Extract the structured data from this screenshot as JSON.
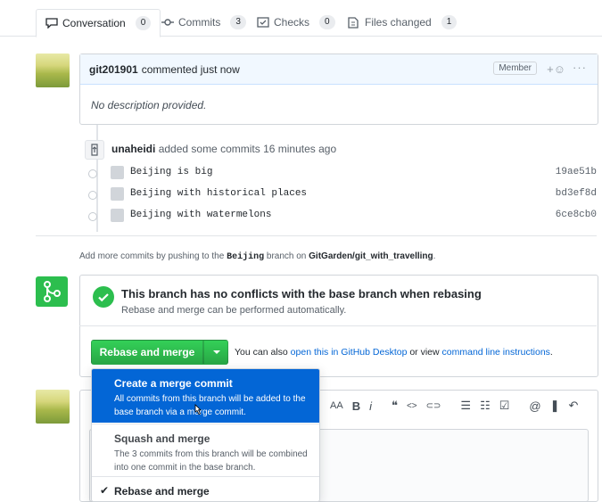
{
  "tabs": [
    {
      "label": "Conversation",
      "count": "0",
      "icon": "conversation-icon"
    },
    {
      "label": "Commits",
      "count": "3",
      "icon": "commit-icon"
    },
    {
      "label": "Checks",
      "count": "0",
      "icon": "checks-icon"
    },
    {
      "label": "Files changed",
      "count": "1",
      "icon": "file-diff-icon"
    }
  ],
  "comment": {
    "author": "git201901",
    "action": "commented just now",
    "badge": "Member",
    "body": "No description provided."
  },
  "timeline": {
    "actor": "unaheidi",
    "text": "added some commits 16 minutes ago",
    "commits": [
      {
        "message": "Beijing is big",
        "sha": "19ae51b"
      },
      {
        "message": "Beijing with historical places",
        "sha": "bd3ef8d"
      },
      {
        "message": "Beijing with watermelons",
        "sha": "6ce8cb0"
      }
    ]
  },
  "push_note": {
    "prefix": "Add more commits by pushing to the",
    "branch": "Beijing",
    "middle": "branch on",
    "repo": "GitGarden/git_with_travelling",
    "suffix": "."
  },
  "merge": {
    "title": "This branch has no conflicts with the base branch when rebasing",
    "subtitle": "Rebase and merge can be performed automatically.",
    "button": "Rebase and merge",
    "also_prefix": "You can also",
    "desktop_link": "open this in GitHub Desktop",
    "also_middle": "or view",
    "cli_link": "command line instructions",
    "also_suffix": ".",
    "accent": "#2cbe4e"
  },
  "dropdown": {
    "items": [
      {
        "title": "Create a merge commit",
        "desc": "All commits from this branch will be added to the base branch via a merge commit.",
        "state": "highlighted"
      },
      {
        "title": "Squash and merge",
        "desc": "The 3 commits from this branch will be combined into one commit in the base branch.",
        "state": "normal"
      },
      {
        "title": "Rebase and merge",
        "desc": "",
        "state": "checked"
      }
    ],
    "highlight_color": "#0366d6"
  },
  "toolbar": {
    "icons": [
      "text-size-icon",
      "bold-icon",
      "italic-icon",
      "quote-icon",
      "code-icon",
      "link-icon",
      "unordered-list-icon",
      "ordered-list-icon",
      "task-list-icon",
      "mention-icon",
      "bookmark-icon",
      "reply-icon"
    ],
    "labels": [
      "AA",
      "B",
      "i",
      "❝",
      "<>",
      "⊂⊃",
      "☰",
      "☷",
      "☑",
      "@",
      "❚",
      "↶"
    ]
  }
}
